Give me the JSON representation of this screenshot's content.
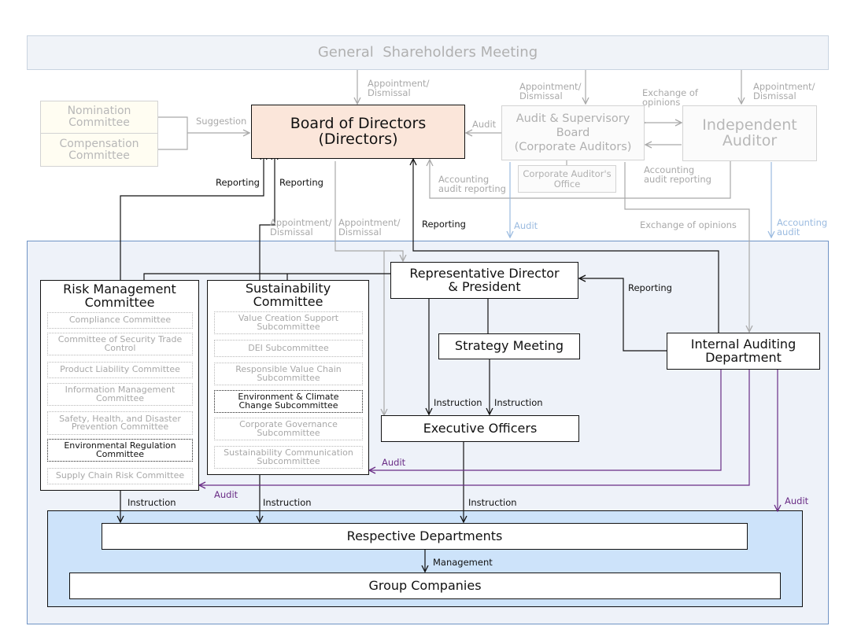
{
  "top": {
    "shareholders": "General  Shareholders Meeting",
    "nomination": [
      "Nomination",
      "Committee"
    ],
    "compensation": [
      "Compensation",
      "Committee"
    ],
    "board": [
      "Board of Directors",
      "(Directors)"
    ],
    "audit_board": [
      "Audit & Supervisory",
      "Board",
      "(Corporate Auditors)"
    ],
    "independent_auditor": [
      "Independent",
      "Auditor"
    ],
    "auditor_office": [
      "Corporate Auditor's",
      "Office"
    ]
  },
  "risk": {
    "title": [
      "Risk Management",
      "Committee"
    ],
    "items": [
      [
        "Compliance Committee"
      ],
      [
        "Committee of Security Trade",
        "Control"
      ],
      [
        "Product Liability Committee"
      ],
      [
        "Information Management",
        "Committee"
      ],
      [
        "Safety, Health, and Disaster",
        "Prevention Committee"
      ],
      [
        "Environmental Regulation",
        "Committee"
      ],
      [
        "Supply Chain Risk Committee"
      ]
    ]
  },
  "sustainability": {
    "title": [
      "Sustainability",
      "Committee"
    ],
    "items": [
      [
        "Value Creation Support",
        "Subcommittee"
      ],
      [
        "DEI Subcommittee"
      ],
      [
        "Responsible Value Chain",
        "Subcommittee"
      ],
      [
        "Environment & Climate",
        "Change Subcommittee"
      ],
      [
        "Corporate Governance",
        "Subcommittee"
      ],
      [
        "Sustainability Communication",
        "Subcommittee"
      ]
    ]
  },
  "exec": {
    "president": [
      "Representative Director",
      "& President"
    ],
    "strategy": "Strategy Meeting",
    "internal_audit": [
      "Internal Auditing",
      "Department"
    ],
    "officers": "Executive Officers"
  },
  "ops": {
    "departments": "Respective Departments",
    "group": "Group Companies"
  },
  "labels": {
    "appt_top": [
      "Appointment/",
      "Dismissal"
    ],
    "appt_mid": [
      "Appointment/",
      "Dismissal"
    ],
    "exchange_opinions": [
      "Exchange of",
      "opinions"
    ],
    "exchange_opinions_long": "Exchange of opinions",
    "suggestion": "Suggestion",
    "audit": "Audit",
    "acct_reporting": [
      "Accounting",
      "audit reporting"
    ],
    "acct_audit": [
      "Accounting",
      "audit"
    ],
    "reporting": "Reporting",
    "instruction": "Instruction",
    "management": "Management"
  },
  "colors": {
    "board_fill": "#fbe6da",
    "region_fill": "#eef2f9",
    "operations_fill": "#cde3fa",
    "audit_purple": "#6a2d86",
    "audit_blue": "#9bbbe0",
    "faded_gray": "#a9a9a9"
  }
}
